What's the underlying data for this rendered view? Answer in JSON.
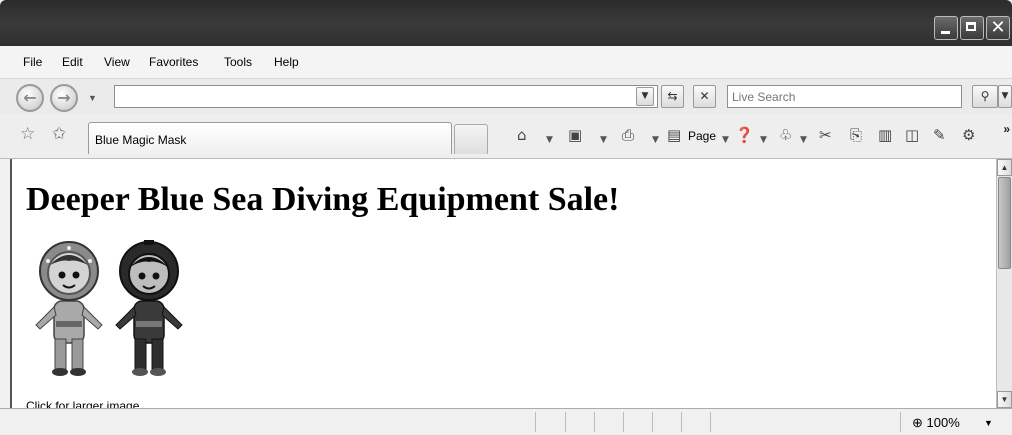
{
  "window": {
    "minimize_glyph": "",
    "maximize_glyph": "",
    "close_glyph": "✕"
  },
  "menu": {
    "items": [
      "File",
      "Edit",
      "View",
      "Favorites",
      "Tools",
      "Help"
    ]
  },
  "address": {
    "value": "",
    "search_placeholder": "Live Search"
  },
  "tab": {
    "title": "Blue Magic Mask"
  },
  "command_bar": {
    "page_label": "Page",
    "more": "»"
  },
  "content": {
    "heading": "Deeper Blue Sea Diving Equipment Sale!",
    "image_alt": "Two cartoon divers in diving suits and helmets",
    "caption": "Click for larger image"
  },
  "status": {
    "zoom": "100%"
  },
  "icons": {
    "back": "arrow-left-icon",
    "forward": "arrow-right-icon",
    "refresh": "refresh-icon",
    "stop": "close-icon",
    "search": "search-icon",
    "favorites": "star-icon",
    "add_favorites": "add-favorite-icon",
    "home": "home-icon",
    "feeds": "rss-icon",
    "print": "printer-icon",
    "help": "help-icon",
    "research": "research-icon",
    "zoom": "zoom-icon"
  }
}
